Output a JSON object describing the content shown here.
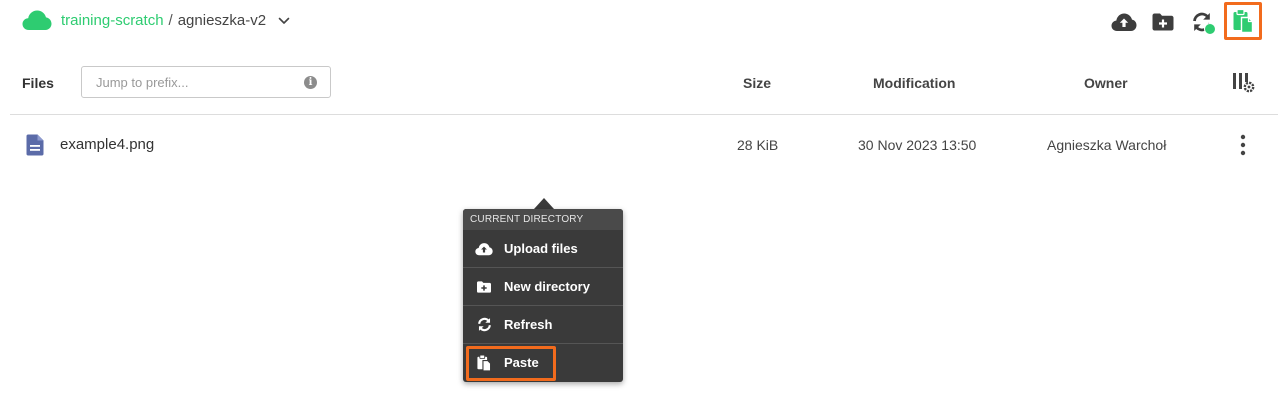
{
  "breadcrumb": {
    "bucket": "training-scratch",
    "separator": "/",
    "folder": "agnieszka-v2"
  },
  "toolbar": {
    "upload_icon": "cloud-upload-icon",
    "new_dir_icon": "folder-plus-icon",
    "refresh_icon": "refresh-icon",
    "paste_icon": "clipboard-paste-icon"
  },
  "table": {
    "files_label": "Files",
    "search_placeholder": "Jump to prefix...",
    "info_glyph": "i",
    "columns": {
      "size": "Size",
      "modification": "Modification",
      "owner": "Owner"
    },
    "rows": [
      {
        "name": "example4.png",
        "size": "28 KiB",
        "modified": "30 Nov 2023 13:50",
        "owner": "Agnieszka Warchoł"
      }
    ]
  },
  "context_menu": {
    "section": "CURRENT DIRECTORY",
    "items": [
      {
        "label": "Upload files",
        "icon": "cloud-upload-icon"
      },
      {
        "label": "New directory",
        "icon": "folder-plus-icon"
      },
      {
        "label": "Refresh",
        "icon": "refresh-icon"
      },
      {
        "label": "Paste",
        "icon": "clipboard-paste-icon"
      }
    ]
  },
  "colors": {
    "accent": "#2ecc71",
    "highlight": "#f26b1d",
    "menu_bg": "#3a3a3a",
    "file_icon": "#5b6ba8"
  }
}
